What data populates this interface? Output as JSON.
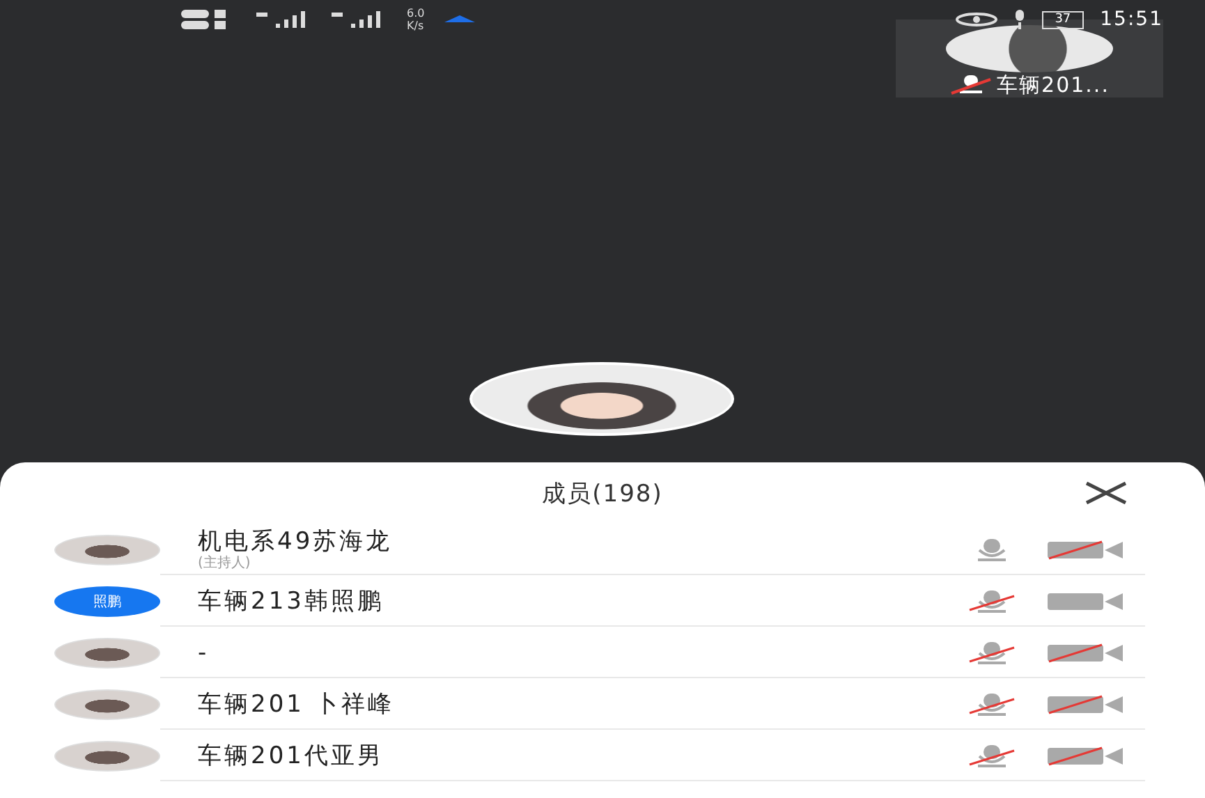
{
  "status_bar": {
    "speed": "6.0",
    "speed_unit": "K/s",
    "battery": "37",
    "time": "15:51"
  },
  "floating_video": {
    "name": "车辆201...",
    "mic_muted": true
  },
  "members_panel": {
    "title": "成员(198)",
    "members": [
      {
        "avatar": {
          "kind": "photo"
        },
        "name": "机电系49苏海龙",
        "role": "(主持人)",
        "mic_muted": false,
        "video_muted": true
      },
      {
        "avatar": {
          "kind": "text",
          "text": "照鹏"
        },
        "name": "车辆213韩照鹏",
        "mic_muted": true,
        "video_muted": false
      },
      {
        "avatar": {
          "kind": "photo"
        },
        "name": "-",
        "mic_muted": true,
        "video_muted": true
      },
      {
        "avatar": {
          "kind": "photo"
        },
        "name": "车辆201 卜祥峰",
        "mic_muted": true,
        "video_muted": true
      },
      {
        "avatar": {
          "kind": "photo"
        },
        "name": "车辆201代亚男",
        "mic_muted": true,
        "video_muted": true
      }
    ]
  }
}
